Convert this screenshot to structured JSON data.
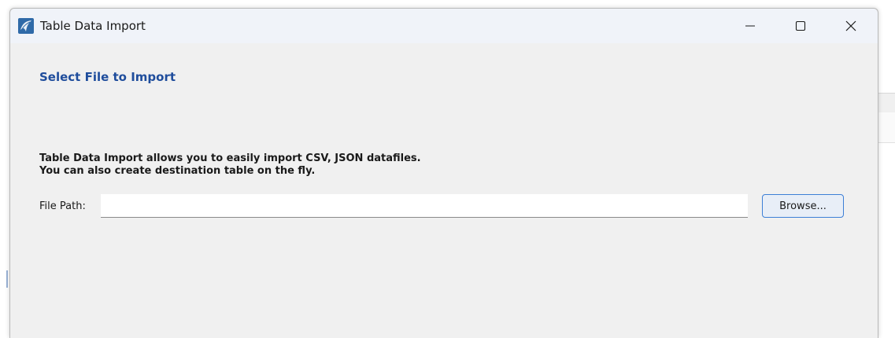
{
  "window": {
    "title": "Table Data Import",
    "controls": {
      "minimize_icon": "minimize-icon",
      "maximize_icon": "maximize-icon",
      "close_icon": "close-icon"
    }
  },
  "content": {
    "heading": "Select File to Import",
    "description_line1": "Table Data Import allows you to easily import CSV, JSON datafiles.",
    "description_line2": "You can also create destination table on the fly.",
    "file_path_label": "File Path:",
    "file_path_value": "",
    "browse_label": "Browse..."
  },
  "colors": {
    "heading": "#1f4d9c",
    "window_bg": "#f0f0f0",
    "titlebar_bg": "#f0f3f9",
    "button_border": "#3c7fd6"
  }
}
